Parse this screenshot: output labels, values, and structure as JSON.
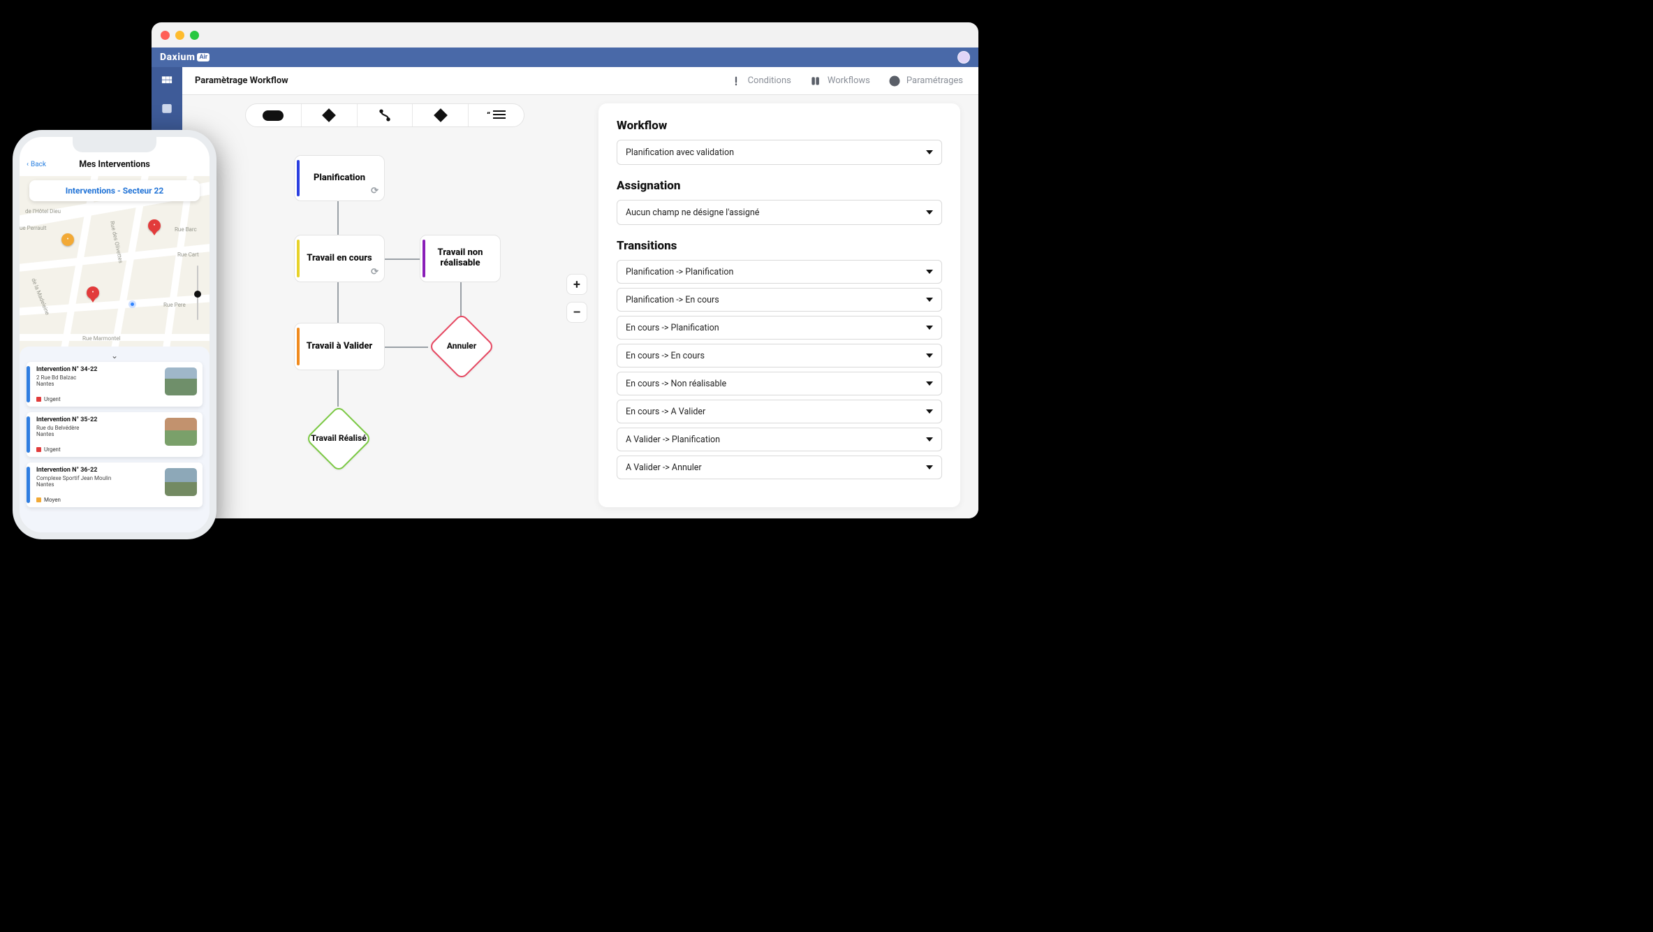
{
  "brand": "Daxium",
  "brand_badge": "Air",
  "page_title": "Paramètrage Workflow",
  "tabs": {
    "conditions": "Conditions",
    "workflows": "Workflows",
    "parametrages": "Paramétrages"
  },
  "zoom": {
    "plus": "+",
    "minus": "–"
  },
  "workflow_nodes": {
    "planification": "Planification",
    "travail_en_cours": "Travail en cours",
    "travail_non_realisable": "Travail non réalisable",
    "travail_a_valider": "Travail à Valider",
    "annuler": "Annuler",
    "travail_realise": "Travail Réalisé"
  },
  "panel": {
    "workflow_heading": "Workflow",
    "workflow_value": "Planification avec validation",
    "assignation_heading": "Assignation",
    "assignation_value": "Aucun champ ne désigne l'assigné",
    "transitions_heading": "Transitions",
    "transitions": [
      "Planification -> Planification",
      "Planification -> En cours",
      "En cours -> Planification",
      "En cours -> En cours",
      "En cours -> Non réalisable",
      "En cours -> A Valider",
      "A Valider -> Planification",
      "A Valider -> Annuler"
    ]
  },
  "phone": {
    "back": "Back",
    "title": "Mes Interventions",
    "section_pill": "Interventions  - Secteur 22",
    "streets": {
      "hotel_dieu": "de l'Hôtel Dieu",
      "perrault": "ue Perrault",
      "bard": "Rue Barc",
      "olivettes": "Rue des Olivettes",
      "cart": "Rue Cart",
      "madeleine": "de la Madeleine",
      "pere": "Rue Pere",
      "marmontel": "Rue Marmontel"
    },
    "cards": [
      {
        "title": "Intervention N° 34-22",
        "addr": "2 Rue Bd Balzac\nNantes",
        "priority": "Urgent",
        "priority_color": "#e13b3b"
      },
      {
        "title": "Intervention N° 35-22",
        "addr": "Rue du Belvédère\nNantes",
        "priority": "Urgent",
        "priority_color": "#e13b3b"
      },
      {
        "title": "Intervention N° 36-22",
        "addr": "Complexe Sportif Jean Moulin\nNantes",
        "priority": "Moyen",
        "priority_color": "#f2a935"
      }
    ]
  }
}
